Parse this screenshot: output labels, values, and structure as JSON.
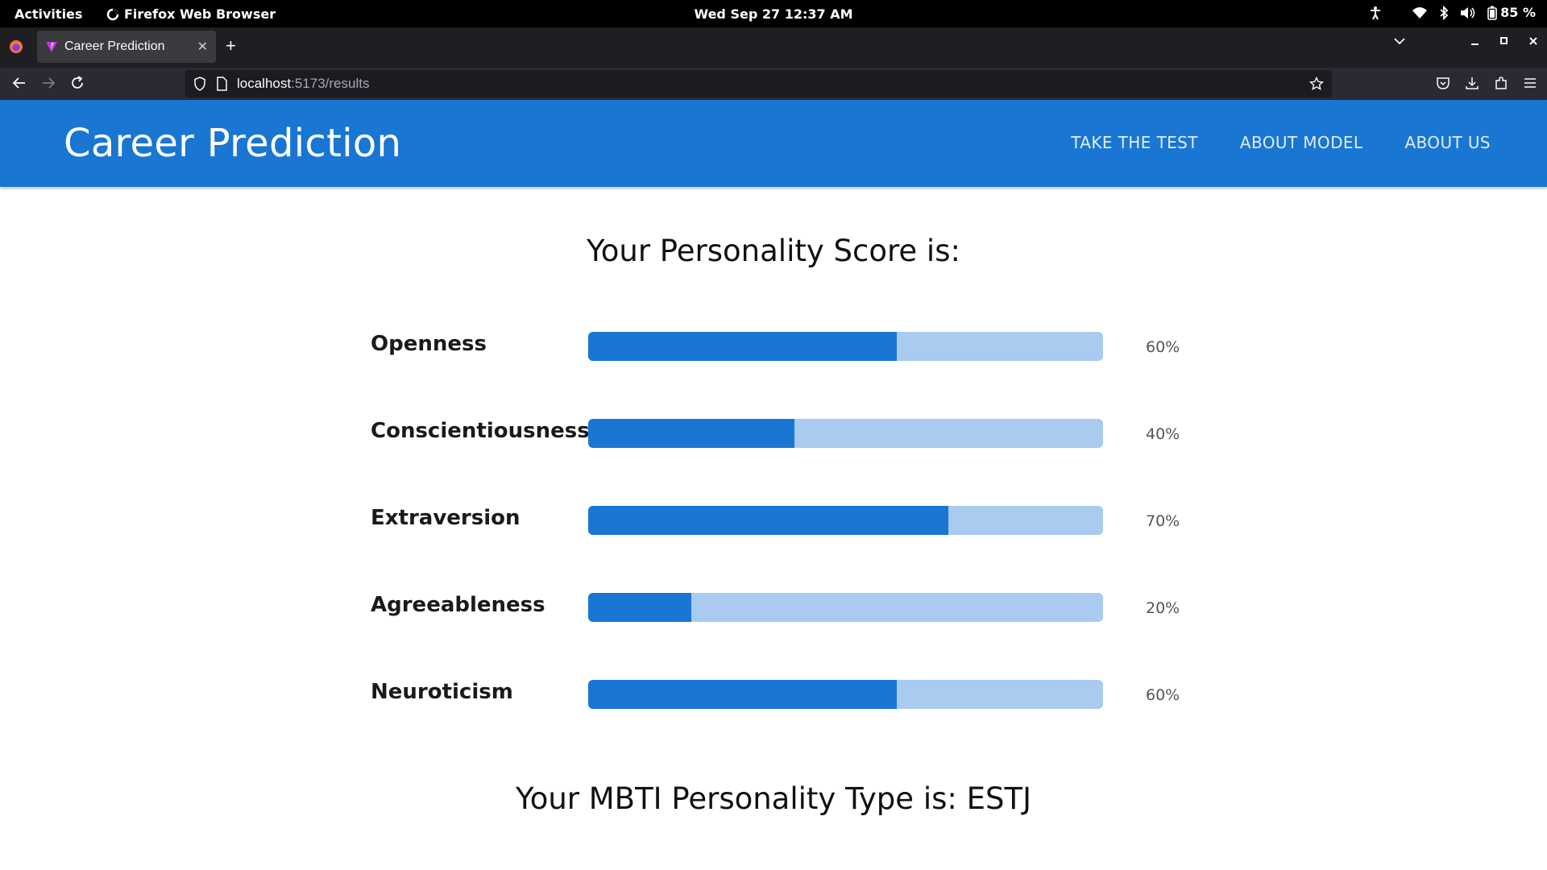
{
  "system_bar": {
    "activities": "Activities",
    "app_name": "Firefox Web Browser",
    "clock": "Wed Sep 27  12:37 AM",
    "battery": "85 %"
  },
  "browser": {
    "tab_title": "Career Prediction",
    "url_host": "localhost",
    "url_rest": ":5173/results"
  },
  "app": {
    "brand": "Career Prediction",
    "menu": [
      "TAKE THE TEST",
      "ABOUT MODEL",
      "ABOUT US"
    ],
    "accent_color": "#1976d2",
    "track_color": "#a8cbef"
  },
  "results": {
    "score_title": "Your Personality Score is:",
    "traits": [
      {
        "name": "Openness",
        "value": 60,
        "label": "60%"
      },
      {
        "name": "Conscientiousness",
        "value": 40,
        "label": "40%"
      },
      {
        "name": "Extraversion",
        "value": 70,
        "label": "70%"
      },
      {
        "name": "Agreeableness",
        "value": 20,
        "label": "20%"
      },
      {
        "name": "Neuroticism",
        "value": 60,
        "label": "60%"
      }
    ],
    "mbti_text": "Your MBTI Personality Type is: ESTJ"
  }
}
